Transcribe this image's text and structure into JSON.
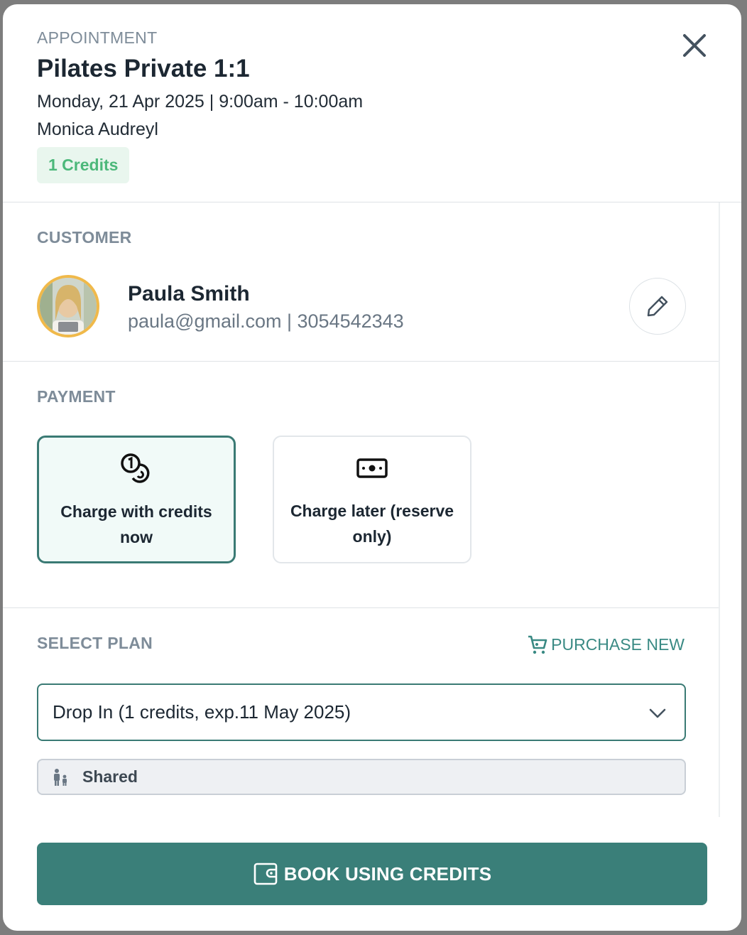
{
  "appointment": {
    "eyebrow": "APPOINTMENT",
    "title": "Pilates Private 1:1",
    "datetime": "Monday, 21 Apr 2025 | 9:00am - 10:00am",
    "instructor": "Monica Audreyl",
    "credits_badge": "1 Credits"
  },
  "customer": {
    "label": "CUSTOMER",
    "name": "Paula Smith",
    "contact": "paula@gmail.com | 3054542343"
  },
  "payment": {
    "label": "PAYMENT",
    "options": [
      {
        "label": "Charge with credits now",
        "icon": "coins-icon",
        "selected": true
      },
      {
        "label": "Charge later (reserve only)",
        "icon": "cash-icon",
        "selected": false
      }
    ]
  },
  "plan": {
    "label": "SELECT PLAN",
    "purchase_new": "PURCHASE NEW",
    "selected_value": "Drop In (1 credits, exp.11 May 2025)",
    "shared_label": "Shared"
  },
  "actions": {
    "book_label": "BOOK USING CREDITS"
  },
  "colors": {
    "accent": "#3a7f79",
    "credits_green": "#4cb87a",
    "avatar_ring": "#f0b94a"
  }
}
